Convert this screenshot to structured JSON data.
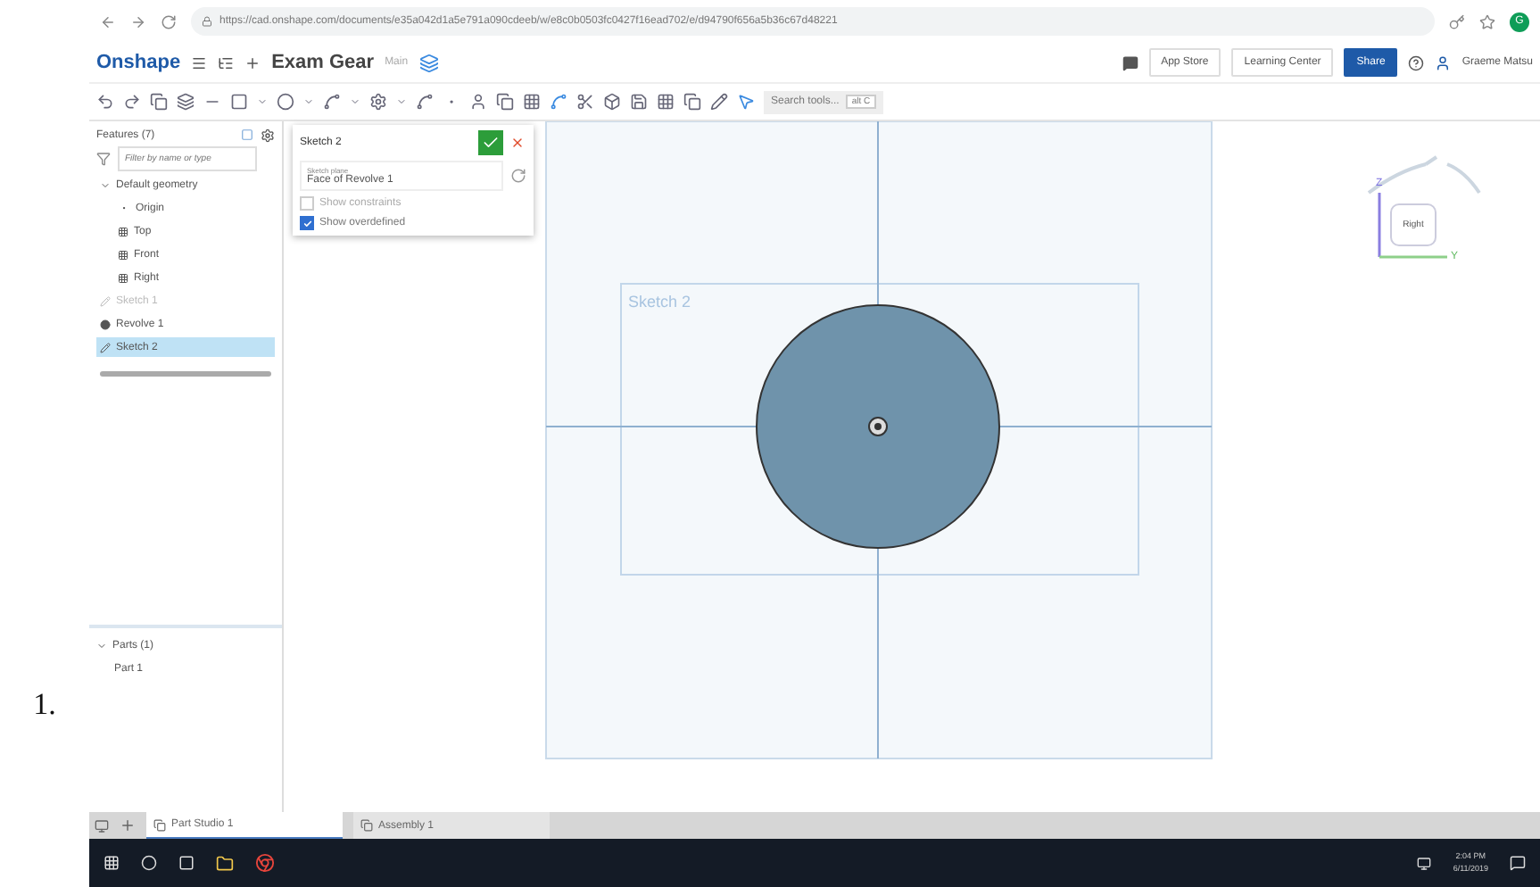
{
  "list_number": "1.",
  "browser": {
    "url": "https://cad.onshape.com/documents/e35a042d1a5e791a090cdeeb/w/e8c0b0503fc0427f16ead702/e/d94790f656a5b36c67d48221",
    "profile_initial": "G"
  },
  "header": {
    "logo": "Onshape",
    "document_title": "Exam Gear",
    "branch": "Main",
    "buttons": [
      {
        "label": "App Store",
        "kind": "plain"
      },
      {
        "label": "Learning Center",
        "kind": "plain"
      },
      {
        "label": "Share",
        "kind": "primary"
      }
    ],
    "user": "Graeme Matsu"
  },
  "toolbar": {
    "search_placeholder": "Search tools...",
    "shortcut": "alt C"
  },
  "features": {
    "title": "Features (7)",
    "filter_placeholder": "Filter by name or type",
    "tree": [
      {
        "label": "Default geometry",
        "kind": "group",
        "expanded": true,
        "selected": false,
        "dimmed": false,
        "children": [
          {
            "label": "Origin",
            "kind": "point",
            "selected": false,
            "dimmed": false
          },
          {
            "label": "Top",
            "kind": "plane",
            "selected": false,
            "dimmed": false
          },
          {
            "label": "Front",
            "kind": "plane",
            "selected": false,
            "dimmed": false
          },
          {
            "label": "Right",
            "kind": "plane",
            "selected": false,
            "dimmed": false
          }
        ]
      },
      {
        "label": "Sketch 1",
        "kind": "sketch",
        "selected": false,
        "dimmed": true
      },
      {
        "label": "Revolve 1",
        "kind": "revolve",
        "selected": false,
        "dimmed": false
      },
      {
        "label": "Sketch 2",
        "kind": "sketch",
        "selected": true,
        "dimmed": false
      }
    ]
  },
  "parts": {
    "title": "Parts (1)",
    "expanded": true,
    "items": [
      "Part 1"
    ]
  },
  "sketch_dialog": {
    "title": "Sketch 2",
    "plane_label": "Sketch plane",
    "plane_value": "Face of Revolve 1",
    "options": [
      {
        "label": "Show constraints",
        "checked": false
      },
      {
        "label": "Show overdefined",
        "checked": true
      }
    ]
  },
  "canvas": {
    "sketch_label": "Sketch 2"
  },
  "view_cube": {
    "face": "Right",
    "axis_vertical": "Z",
    "axis_horizontal": "Y"
  },
  "tabs": [
    {
      "label": "Part Studio 1",
      "selected": true
    },
    {
      "label": "Assembly 1",
      "selected": false
    }
  ],
  "taskbar": {
    "time": "2:04 PM",
    "date": "6/11/2019"
  }
}
